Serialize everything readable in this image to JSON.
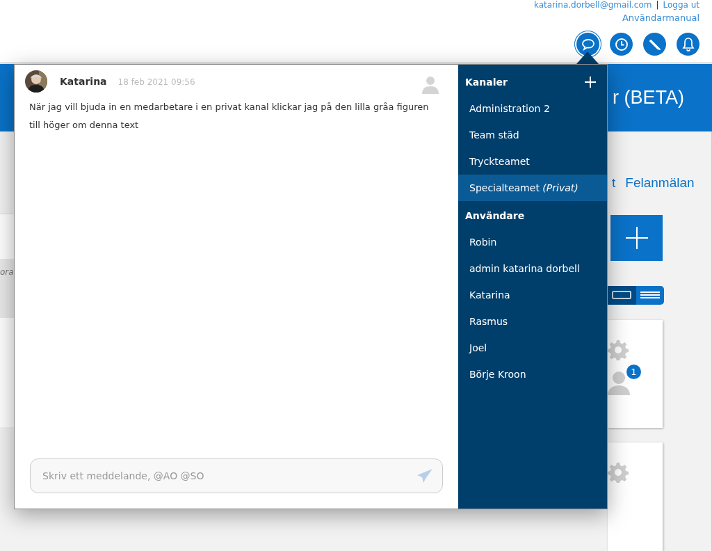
{
  "header": {
    "email": "katarina.dorbell@gmail.com",
    "separator": "|",
    "logout": "Logga ut",
    "manual": "Användarmanual",
    "icons": [
      {
        "kind": "chat",
        "selected": true
      },
      {
        "kind": "clock",
        "selected": false
      },
      {
        "kind": "pencil",
        "selected": false
      },
      {
        "kind": "bell",
        "selected": false
      }
    ]
  },
  "banner": {
    "title": "r (BETA)"
  },
  "nav": [
    "t",
    "Felanmälan"
  ],
  "list_hint": "ora",
  "view_toggle": [
    {
      "kind": "cards",
      "selected": false
    },
    {
      "kind": "list",
      "selected": true
    }
  ],
  "cards": [
    {
      "kind": "assigned",
      "badge": "1"
    },
    {
      "kind": "plain"
    }
  ],
  "chat": {
    "messages": [
      {
        "author": "Katarina",
        "time": "18 feb 2021 09:56",
        "text": "När jag vill bjuda in en medarbetare i en privat kanal klickar jag på den lilla gråa figuren till höger om denna text"
      }
    ],
    "input": {
      "placeholder": "Skriv ett meddelande, @AO @SO"
    },
    "sidebar": {
      "channels_heading": "Kanaler",
      "channels": [
        {
          "label": "Administration 2",
          "selected": false
        },
        {
          "label": "Team städ",
          "selected": false
        },
        {
          "label": "Tryckteamet",
          "selected": false
        },
        {
          "label": "Specialteamet *(Privat)*",
          "selected": true
        }
      ],
      "users_heading": "Användare",
      "users": [
        {
          "label": "Robin",
          "selected": false
        },
        {
          "label": "admin katarina dorbell",
          "selected": false
        },
        {
          "label": "Katarina",
          "selected": false
        },
        {
          "label": "Rasmus",
          "selected": false
        },
        {
          "label": "Joel",
          "selected": false
        },
        {
          "label": "Börje Kroon",
          "selected": false
        }
      ]
    }
  }
}
